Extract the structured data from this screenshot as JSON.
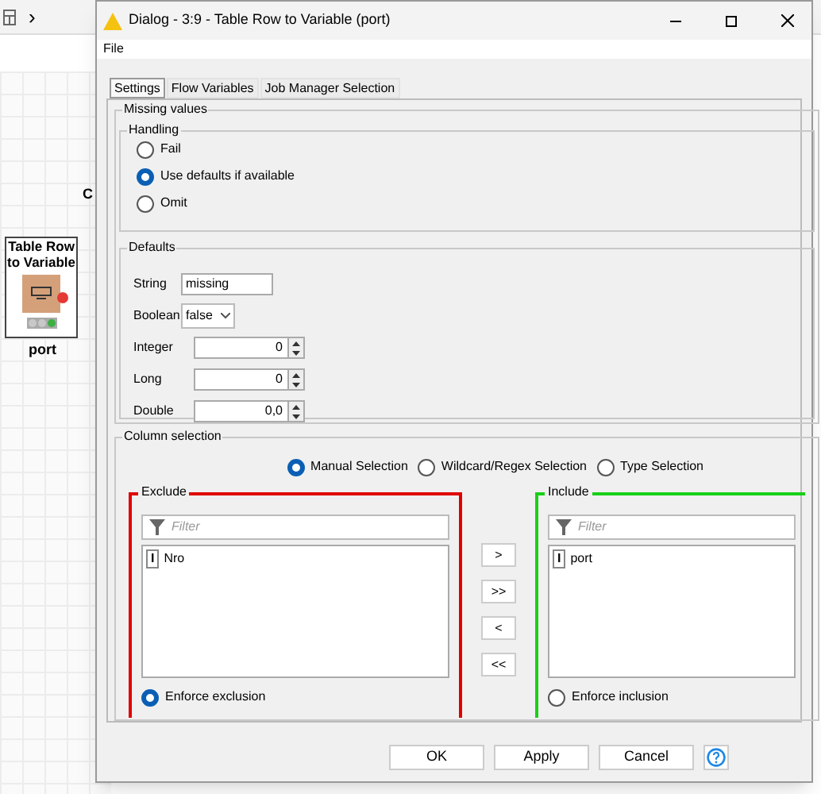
{
  "canvas": {
    "toolbar_chevron": "›",
    "partial_label": "C",
    "node": {
      "title_lines": [
        "Table Row",
        "to Variable"
      ],
      "label": "port",
      "status_lights": [
        {
          "color": "#c8c8c8"
        },
        {
          "color": "#c8c8c8"
        },
        {
          "color": "#3cb043"
        }
      ]
    }
  },
  "dialog": {
    "title": "Dialog - 3:9 - Table Row to Variable (port)",
    "menu": [
      "File"
    ],
    "tabs": [
      {
        "label": "Settings",
        "selected": true
      },
      {
        "label": "Flow Variables",
        "selected": false
      },
      {
        "label": "Job Manager Selection",
        "selected": false
      }
    ],
    "missing_values": {
      "title": "Missing values",
      "handling": {
        "title": "Handling",
        "options": [
          {
            "label": "Fail",
            "selected": false
          },
          {
            "label": "Use defaults if available",
            "selected": true
          },
          {
            "label": "Omit",
            "selected": false
          }
        ]
      },
      "defaults": {
        "title": "Defaults",
        "fields": [
          {
            "kind": "text",
            "label": "String",
            "value": "missing"
          },
          {
            "kind": "select",
            "label": "Boolean",
            "value": "false"
          },
          {
            "kind": "spinner",
            "label": "Integer",
            "value": "0"
          },
          {
            "kind": "spinner",
            "label": "Long",
            "value": "0"
          },
          {
            "kind": "spinner",
            "label": "Double",
            "value": "0,0"
          }
        ]
      }
    },
    "column_selection": {
      "title": "Column selection",
      "modes": [
        {
          "label": "Manual Selection",
          "selected": true
        },
        {
          "label": "Wildcard/Regex Selection",
          "selected": false
        },
        {
          "label": "Type Selection",
          "selected": false
        }
      ],
      "exclude": {
        "title": "Exclude",
        "filter_placeholder": "Filter",
        "items": [
          {
            "type_badge": "I",
            "name": "Nro"
          }
        ],
        "enforce": {
          "label": "Enforce exclusion",
          "selected": true
        }
      },
      "move_buttons": [
        ">",
        ">>",
        "<",
        "<<"
      ],
      "include": {
        "title": "Include",
        "filter_placeholder": "Filter",
        "items": [
          {
            "type_badge": "I",
            "name": "port"
          }
        ],
        "enforce": {
          "label": "Enforce inclusion",
          "selected": false
        }
      }
    },
    "buttons": [
      "OK",
      "Apply",
      "Cancel"
    ]
  }
}
